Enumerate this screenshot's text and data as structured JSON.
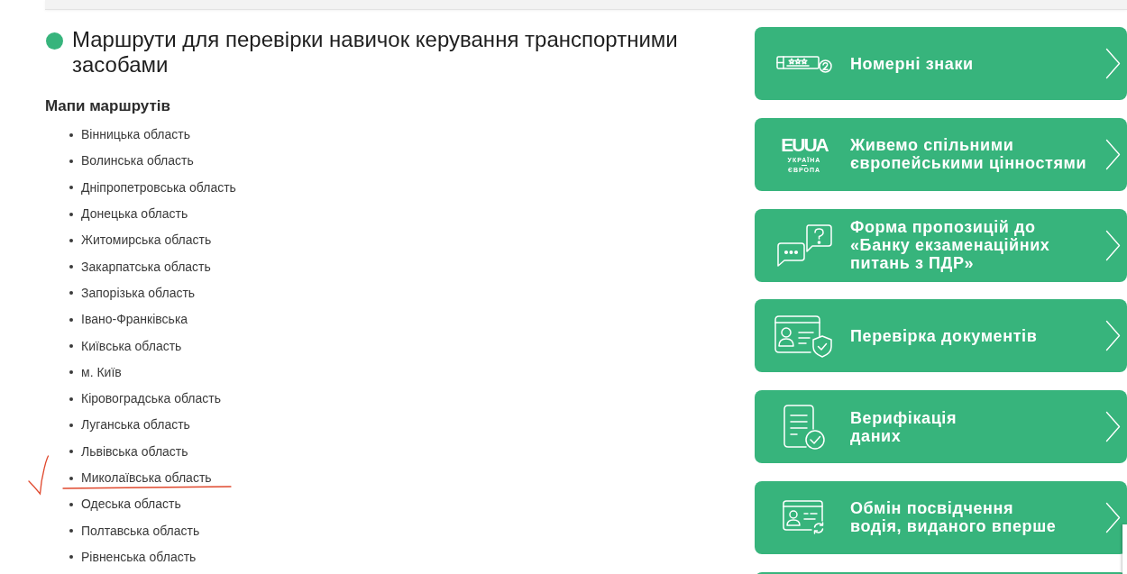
{
  "page": {
    "title": "Маршрути для перевірки навичок керування транспортними засобами",
    "section_title": "Мапи маршрутів"
  },
  "regions": [
    {
      "name": "Вінницька область",
      "marked": false
    },
    {
      "name": "Волинська область",
      "marked": false
    },
    {
      "name": "Дніпропетровська область",
      "marked": false
    },
    {
      "name": "Донецька область",
      "marked": false
    },
    {
      "name": "Житомирська область",
      "marked": false
    },
    {
      "name": "Закарпатська область",
      "marked": false
    },
    {
      "name": "Запорізька область",
      "marked": false
    },
    {
      "name": "Івано-Франківська",
      "marked": false
    },
    {
      "name": "Київська область",
      "marked": false
    },
    {
      "name": "м. Київ",
      "marked": false
    },
    {
      "name": "Кіровоградська область",
      "marked": false
    },
    {
      "name": "Луганська область",
      "marked": false
    },
    {
      "name": "Львівська область",
      "marked": false
    },
    {
      "name": "Миколаївська область",
      "marked": true
    },
    {
      "name": "Одеська область",
      "marked": false
    },
    {
      "name": "Полтавська область",
      "marked": false
    },
    {
      "name": "Рівненська область",
      "marked": false
    }
  ],
  "services": [
    {
      "kind": "plates",
      "lines": [
        "Номерні знаки"
      ]
    },
    {
      "kind": "eu-ua",
      "lines": [
        "Живемо спільними",
        "європейськими цінностями"
      ],
      "logo": {
        "wordmark": [
          "EU",
          "UA"
        ],
        "caption": [
          "УКРАЇНА",
          "ЄВРОПА"
        ]
      }
    },
    {
      "kind": "questions",
      "lines": [
        "Форма пропозицій до",
        "«Банку екзаменаційних",
        "питань з ПДР»"
      ]
    },
    {
      "kind": "documents",
      "lines": [
        "Перевірка документів"
      ]
    },
    {
      "kind": "verification",
      "lines": [
        "Верифікація",
        "даних"
      ]
    },
    {
      "kind": "exchange",
      "lines": [
        "Обмін посвідчення",
        "водія, виданого вперше"
      ]
    },
    {
      "kind": "cut-off"
    }
  ]
}
